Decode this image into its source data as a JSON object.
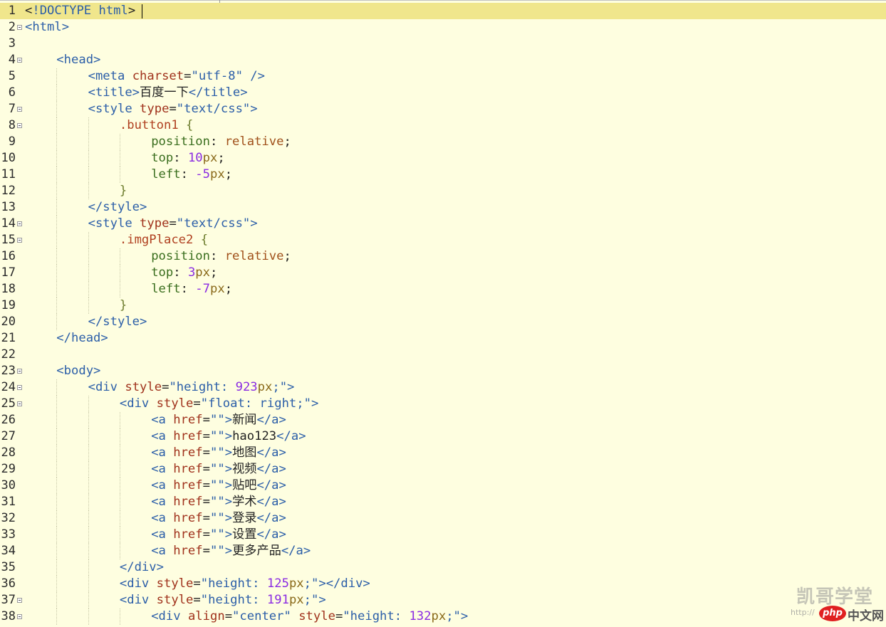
{
  "editor": {
    "lines": [
      {
        "n": "1",
        "fold": false,
        "indent": 0,
        "tokens": [
          [
            "t-punc",
            "<"
          ],
          [
            "t-tag",
            "!DOCTYPE html"
          ],
          [
            "t-punc",
            ">"
          ]
        ]
      },
      {
        "n": "2",
        "fold": true,
        "indent": 0,
        "tokens": [
          [
            "t-tag",
            "<html>"
          ]
        ]
      },
      {
        "n": "3",
        "fold": false,
        "indent": 0,
        "tokens": []
      },
      {
        "n": "4",
        "fold": true,
        "indent": 1,
        "tokens": [
          [
            "t-tag",
            "<head>"
          ]
        ]
      },
      {
        "n": "5",
        "fold": false,
        "indent": 2,
        "tokens": [
          [
            "t-tag",
            "<meta "
          ],
          [
            "t-attr",
            "charset"
          ],
          [
            "t-punc",
            "="
          ],
          [
            "t-str",
            "\"utf-8\""
          ],
          [
            "t-tag",
            " />"
          ]
        ]
      },
      {
        "n": "6",
        "fold": false,
        "indent": 2,
        "tokens": [
          [
            "t-tag",
            "<title>"
          ],
          [
            "t-txt",
            "百度一下"
          ],
          [
            "t-tag",
            "</title>"
          ]
        ]
      },
      {
        "n": "7",
        "fold": true,
        "indent": 2,
        "tokens": [
          [
            "t-tag",
            "<style "
          ],
          [
            "t-attr",
            "type"
          ],
          [
            "t-punc",
            "="
          ],
          [
            "t-str",
            "\"text/css\""
          ],
          [
            "t-tag",
            ">"
          ]
        ]
      },
      {
        "n": "8",
        "fold": true,
        "indent": 3,
        "tokens": [
          [
            "t-sel",
            ".button1 "
          ],
          [
            "t-brace",
            "{"
          ]
        ]
      },
      {
        "n": "9",
        "fold": false,
        "indent": 4,
        "tokens": [
          [
            "t-prop",
            "position"
          ],
          [
            "t-punc",
            ": "
          ],
          [
            "t-val",
            "relative"
          ],
          [
            "t-punc",
            ";"
          ]
        ]
      },
      {
        "n": "10",
        "fold": false,
        "indent": 4,
        "tokens": [
          [
            "t-prop",
            "top"
          ],
          [
            "t-punc",
            ": "
          ],
          [
            "t-num",
            "10"
          ],
          [
            "t-unit",
            "px"
          ],
          [
            "t-punc",
            ";"
          ]
        ]
      },
      {
        "n": "11",
        "fold": false,
        "indent": 4,
        "tokens": [
          [
            "t-prop",
            "left"
          ],
          [
            "t-punc",
            ": "
          ],
          [
            "t-num",
            "-5"
          ],
          [
            "t-unit",
            "px"
          ],
          [
            "t-punc",
            ";"
          ]
        ]
      },
      {
        "n": "12",
        "fold": false,
        "indent": 3,
        "tokens": [
          [
            "t-brace",
            "}"
          ]
        ]
      },
      {
        "n": "13",
        "fold": false,
        "indent": 2,
        "tokens": [
          [
            "t-tag",
            "</style>"
          ]
        ]
      },
      {
        "n": "14",
        "fold": true,
        "indent": 2,
        "tokens": [
          [
            "t-tag",
            "<style "
          ],
          [
            "t-attr",
            "type"
          ],
          [
            "t-punc",
            "="
          ],
          [
            "t-str",
            "\"text/css\""
          ],
          [
            "t-tag",
            ">"
          ]
        ]
      },
      {
        "n": "15",
        "fold": true,
        "indent": 3,
        "tokens": [
          [
            "t-sel",
            ".imgPlace2 "
          ],
          [
            "t-brace",
            "{"
          ]
        ]
      },
      {
        "n": "16",
        "fold": false,
        "indent": 4,
        "tokens": [
          [
            "t-prop",
            "position"
          ],
          [
            "t-punc",
            ": "
          ],
          [
            "t-val",
            "relative"
          ],
          [
            "t-punc",
            ";"
          ]
        ]
      },
      {
        "n": "17",
        "fold": false,
        "indent": 4,
        "tokens": [
          [
            "t-prop",
            "top"
          ],
          [
            "t-punc",
            ": "
          ],
          [
            "t-num",
            "3"
          ],
          [
            "t-unit",
            "px"
          ],
          [
            "t-punc",
            ";"
          ]
        ]
      },
      {
        "n": "18",
        "fold": false,
        "indent": 4,
        "tokens": [
          [
            "t-prop",
            "left"
          ],
          [
            "t-punc",
            ": "
          ],
          [
            "t-num",
            "-7"
          ],
          [
            "t-unit",
            "px"
          ],
          [
            "t-punc",
            ";"
          ]
        ]
      },
      {
        "n": "19",
        "fold": false,
        "indent": 3,
        "tokens": [
          [
            "t-brace",
            "}"
          ]
        ]
      },
      {
        "n": "20",
        "fold": false,
        "indent": 2,
        "tokens": [
          [
            "t-tag",
            "</style>"
          ]
        ]
      },
      {
        "n": "21",
        "fold": false,
        "indent": 1,
        "tokens": [
          [
            "t-tag",
            "</head>"
          ]
        ]
      },
      {
        "n": "22",
        "fold": false,
        "indent": 0,
        "tokens": []
      },
      {
        "n": "23",
        "fold": true,
        "indent": 1,
        "tokens": [
          [
            "t-tag",
            "<body>"
          ]
        ]
      },
      {
        "n": "24",
        "fold": true,
        "indent": 2,
        "tokens": [
          [
            "t-tag",
            "<div "
          ],
          [
            "t-attr",
            "style"
          ],
          [
            "t-punc",
            "="
          ],
          [
            "t-str",
            "\"height: "
          ],
          [
            "t-num",
            "923"
          ],
          [
            "t-unit",
            "px"
          ],
          [
            "t-str",
            ";\""
          ],
          [
            "t-tag",
            ">"
          ]
        ]
      },
      {
        "n": "25",
        "fold": true,
        "indent": 3,
        "tokens": [
          [
            "t-tag",
            "<div "
          ],
          [
            "t-attr",
            "style"
          ],
          [
            "t-punc",
            "="
          ],
          [
            "t-str",
            "\"float: right;\""
          ],
          [
            "t-tag",
            ">"
          ]
        ]
      },
      {
        "n": "26",
        "fold": false,
        "indent": 4,
        "tokens": [
          [
            "t-tag",
            "<a "
          ],
          [
            "t-attr",
            "href"
          ],
          [
            "t-punc",
            "="
          ],
          [
            "t-str",
            "\"\""
          ],
          [
            "t-tag",
            ">"
          ],
          [
            "t-txt",
            "新闻"
          ],
          [
            "t-tag",
            "</a>"
          ]
        ]
      },
      {
        "n": "27",
        "fold": false,
        "indent": 4,
        "tokens": [
          [
            "t-tag",
            "<a "
          ],
          [
            "t-attr",
            "href"
          ],
          [
            "t-punc",
            "="
          ],
          [
            "t-str",
            "\"\""
          ],
          [
            "t-tag",
            ">"
          ],
          [
            "t-txt",
            "hao123"
          ],
          [
            "t-tag",
            "</a>"
          ]
        ]
      },
      {
        "n": "28",
        "fold": false,
        "indent": 4,
        "tokens": [
          [
            "t-tag",
            "<a "
          ],
          [
            "t-attr",
            "href"
          ],
          [
            "t-punc",
            "="
          ],
          [
            "t-str",
            "\"\""
          ],
          [
            "t-tag",
            ">"
          ],
          [
            "t-txt",
            "地图"
          ],
          [
            "t-tag",
            "</a>"
          ]
        ]
      },
      {
        "n": "29",
        "fold": false,
        "indent": 4,
        "tokens": [
          [
            "t-tag",
            "<a "
          ],
          [
            "t-attr",
            "href"
          ],
          [
            "t-punc",
            "="
          ],
          [
            "t-str",
            "\"\""
          ],
          [
            "t-tag",
            ">"
          ],
          [
            "t-txt",
            "视频"
          ],
          [
            "t-tag",
            "</a>"
          ]
        ]
      },
      {
        "n": "30",
        "fold": false,
        "indent": 4,
        "tokens": [
          [
            "t-tag",
            "<a "
          ],
          [
            "t-attr",
            "href"
          ],
          [
            "t-punc",
            "="
          ],
          [
            "t-str",
            "\"\""
          ],
          [
            "t-tag",
            ">"
          ],
          [
            "t-txt",
            "贴吧"
          ],
          [
            "t-tag",
            "</a>"
          ]
        ]
      },
      {
        "n": "31",
        "fold": false,
        "indent": 4,
        "tokens": [
          [
            "t-tag",
            "<a "
          ],
          [
            "t-attr",
            "href"
          ],
          [
            "t-punc",
            "="
          ],
          [
            "t-str",
            "\"\""
          ],
          [
            "t-tag",
            ">"
          ],
          [
            "t-txt",
            "学术"
          ],
          [
            "t-tag",
            "</a>"
          ]
        ]
      },
      {
        "n": "32",
        "fold": false,
        "indent": 4,
        "tokens": [
          [
            "t-tag",
            "<a "
          ],
          [
            "t-attr",
            "href"
          ],
          [
            "t-punc",
            "="
          ],
          [
            "t-str",
            "\"\""
          ],
          [
            "t-tag",
            ">"
          ],
          [
            "t-txt",
            "登录"
          ],
          [
            "t-tag",
            "</a>"
          ]
        ]
      },
      {
        "n": "33",
        "fold": false,
        "indent": 4,
        "tokens": [
          [
            "t-tag",
            "<a "
          ],
          [
            "t-attr",
            "href"
          ],
          [
            "t-punc",
            "="
          ],
          [
            "t-str",
            "\"\""
          ],
          [
            "t-tag",
            ">"
          ],
          [
            "t-txt",
            "设置"
          ],
          [
            "t-tag",
            "</a>"
          ]
        ]
      },
      {
        "n": "34",
        "fold": false,
        "indent": 4,
        "tokens": [
          [
            "t-tag",
            "<a "
          ],
          [
            "t-attr",
            "href"
          ],
          [
            "t-punc",
            "="
          ],
          [
            "t-str",
            "\"\""
          ],
          [
            "t-tag",
            ">"
          ],
          [
            "t-txt",
            "更多产品"
          ],
          [
            "t-tag",
            "</a>"
          ]
        ]
      },
      {
        "n": "35",
        "fold": false,
        "indent": 3,
        "tokens": [
          [
            "t-tag",
            "</div>"
          ]
        ]
      },
      {
        "n": "36",
        "fold": false,
        "indent": 3,
        "tokens": [
          [
            "t-tag",
            "<div "
          ],
          [
            "t-attr",
            "style"
          ],
          [
            "t-punc",
            "="
          ],
          [
            "t-str",
            "\"height: "
          ],
          [
            "t-num",
            "125"
          ],
          [
            "t-unit",
            "px"
          ],
          [
            "t-str",
            ";\""
          ],
          [
            "t-tag",
            "></div>"
          ]
        ]
      },
      {
        "n": "37",
        "fold": true,
        "indent": 3,
        "tokens": [
          [
            "t-tag",
            "<div "
          ],
          [
            "t-attr",
            "style"
          ],
          [
            "t-punc",
            "="
          ],
          [
            "t-str",
            "\"height: "
          ],
          [
            "t-num",
            "191"
          ],
          [
            "t-unit",
            "px"
          ],
          [
            "t-str",
            ";\""
          ],
          [
            "t-tag",
            ">"
          ]
        ]
      },
      {
        "n": "38",
        "fold": true,
        "indent": 4,
        "tokens": [
          [
            "t-tag",
            "<div "
          ],
          [
            "t-attr",
            "align"
          ],
          [
            "t-punc",
            "="
          ],
          [
            "t-str",
            "\"center\" "
          ],
          [
            "t-attr",
            "style"
          ],
          [
            "t-punc",
            "="
          ],
          [
            "t-str",
            "\"height: "
          ],
          [
            "t-num",
            "132"
          ],
          [
            "t-unit",
            "px"
          ],
          [
            "t-str",
            ";\""
          ],
          [
            "t-tag",
            ">"
          ]
        ]
      }
    ]
  },
  "watermark": {
    "title": "凯哥学堂",
    "url": "http://",
    "php": "php",
    "site": "中文网"
  }
}
